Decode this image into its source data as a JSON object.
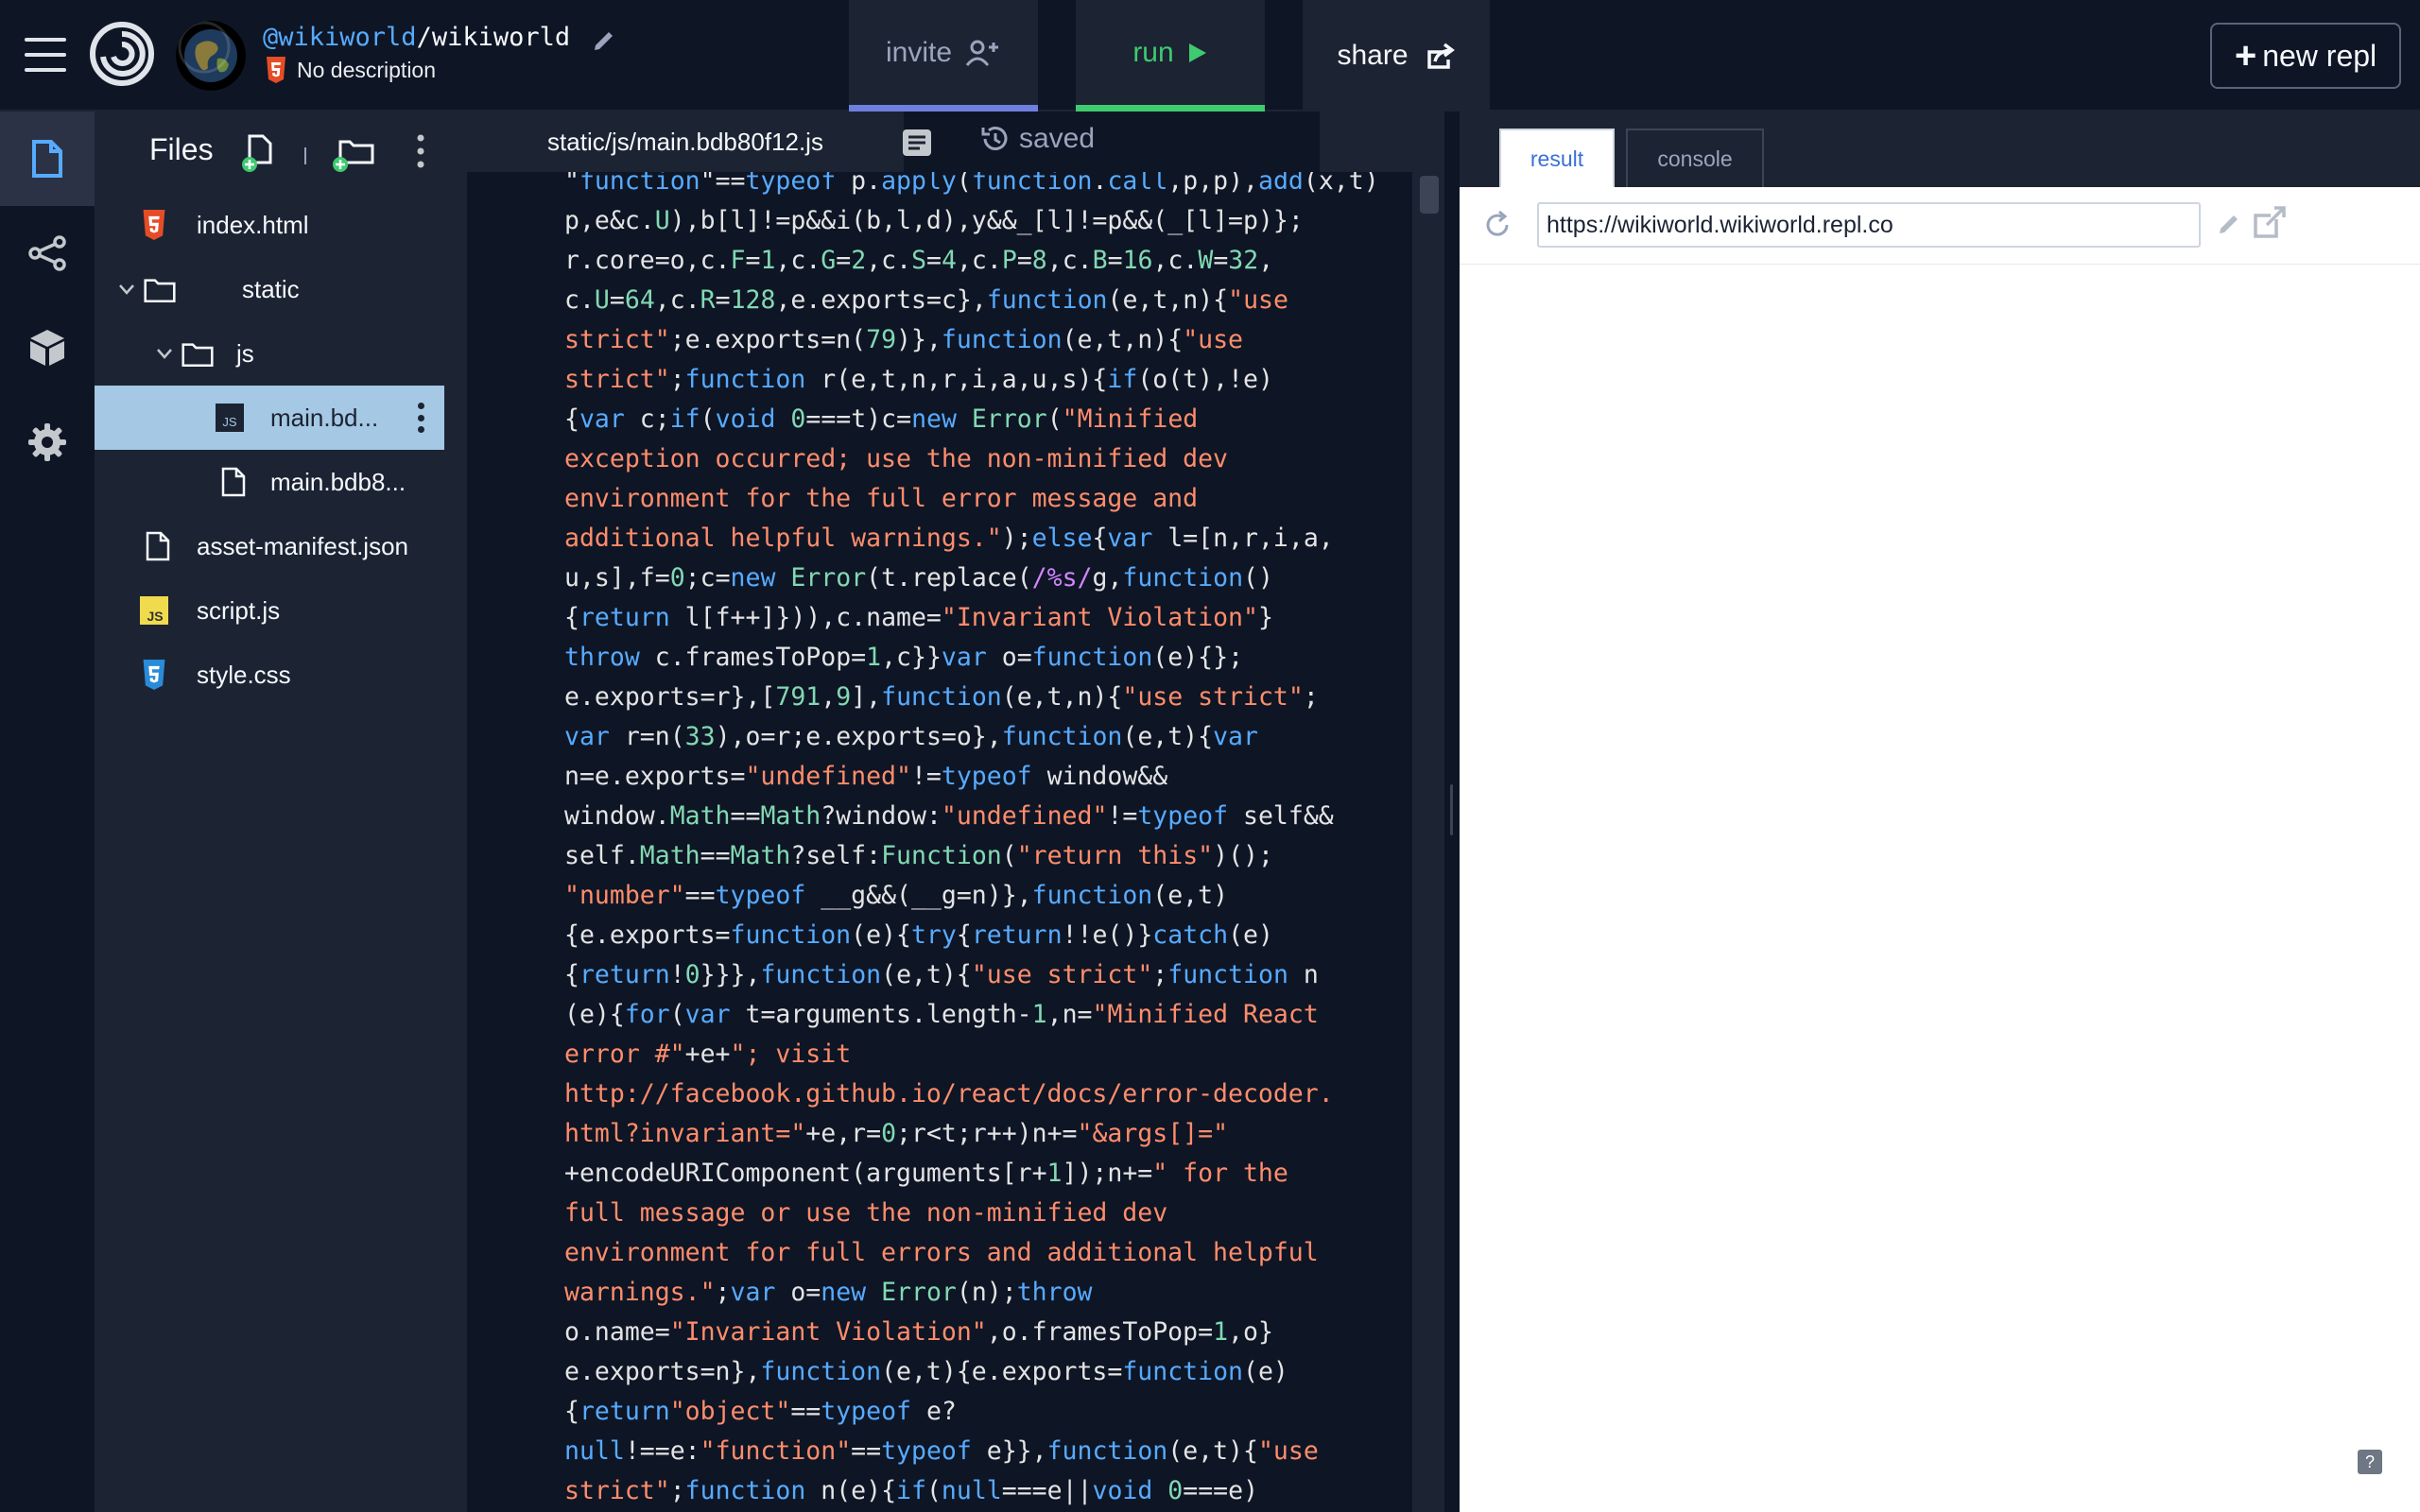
{
  "header": {
    "username": "@wikiworld",
    "separator": "/",
    "repl_name": "wikiworld",
    "description": "No description",
    "invite_label": "invite",
    "run_label": "run",
    "share_label": "share",
    "new_repl_label": "new repl",
    "new_repl_plus": "+"
  },
  "files": {
    "title": "Files",
    "items": [
      {
        "label": "index.html"
      },
      {
        "label": "static"
      },
      {
        "label": "js"
      },
      {
        "label": "main.bd..."
      },
      {
        "label": "main.bdb8..."
      },
      {
        "label": "asset-manifest.json"
      },
      {
        "label": "script.js"
      },
      {
        "label": "style.css"
      }
    ]
  },
  "editor": {
    "file_path": "static/js/main.bdb80f12.js",
    "status": "saved"
  },
  "preview": {
    "tab_result": "result",
    "tab_console": "console",
    "url": "https://wikiworld.wikiworld.repl.co",
    "help": "?"
  },
  "colors": {
    "background": "#0e1525",
    "panel": "#1c2333",
    "run_green": "#3fca6f",
    "invite_accent": "#6f7fe0",
    "selection": "#a5c8e4",
    "keyword": "#57abff",
    "string": "#ff8d6b",
    "number": "#82d9b2"
  }
}
